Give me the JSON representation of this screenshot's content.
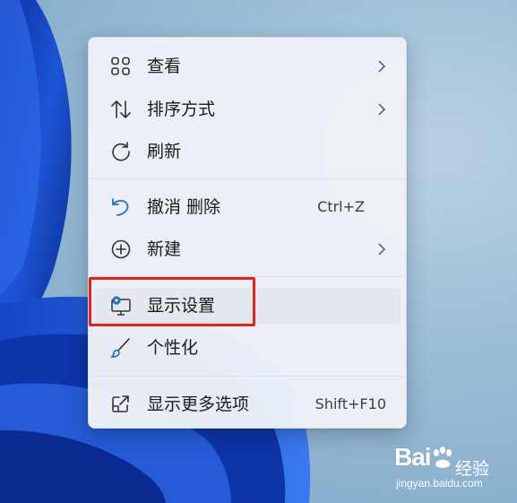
{
  "menu": {
    "items": [
      {
        "label": "查看",
        "icon": "grid-view-icon",
        "submenu": true
      },
      {
        "label": "排序方式",
        "icon": "sort-arrows-icon",
        "submenu": true
      },
      {
        "label": "刷新",
        "icon": "refresh-icon",
        "submenu": false
      },
      {
        "label": "撤消 删除",
        "icon": "undo-icon",
        "shortcut": "Ctrl+Z"
      },
      {
        "label": "新建",
        "icon": "add-circle-icon",
        "submenu": true
      },
      {
        "label": "显示设置",
        "icon": "display-settings-icon",
        "highlighted": true
      },
      {
        "label": "个性化",
        "icon": "brush-icon",
        "submenu": false
      },
      {
        "label": "显示更多选项",
        "icon": "open-external-icon",
        "shortcut": "Shift+F10"
      }
    ]
  },
  "annotation": {
    "color": "#e8201a"
  },
  "colors": {
    "accent": "#1a73c8",
    "highlight_box": "#e8201a"
  },
  "watermark": {
    "brand": "Bai",
    "brand_suffix": "经验",
    "url": "jingyan.baidu.com"
  }
}
